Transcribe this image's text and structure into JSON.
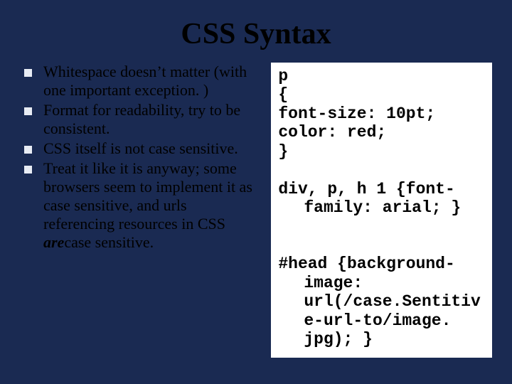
{
  "title": "CSS Syntax",
  "bullets": [
    {
      "text": "Whitespace doesn’t matter (with one important exception. )"
    },
    {
      "text": "Format for readability, try to be consistent."
    },
    {
      "text": "CSS itself is not case sensitive."
    },
    {
      "text_pre": "Treat it like it is anyway; some browsers seem to implement it as case sensitive, and urls referencing resources in CSS ",
      "em": "are",
      "text_post": "case sensitive."
    }
  ],
  "code": {
    "l1": "p",
    "l2": "{",
    "l3": "font-size: 10pt;",
    "l4": "color: red;",
    "l5": "}",
    "l6": "div, p, h 1 {font-family: arial; }",
    "l7": "#head {background-image: url(/case.Sentitive-url-to/image. jpg); }"
  }
}
